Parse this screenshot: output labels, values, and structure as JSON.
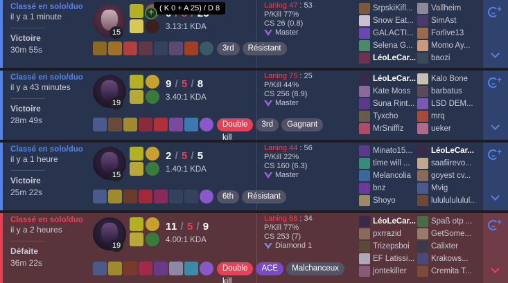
{
  "tooltip": "( K 0 + A 25) / D 8",
  "matches": [
    {
      "result_class": "win",
      "queue": "Classé en solo/duo",
      "ago": "il y a 1 minute",
      "result": "Victoire",
      "duration": "30m 55s",
      "level": "15",
      "kills": "0",
      "deaths": "8",
      "assists": "25",
      "kda_ratio": "3.13:1 KDA",
      "badges": [
        "3rd",
        "Résistant"
      ],
      "laning": "Laning 47",
      "laning_opp": "53",
      "pkill": "P/Kill 77%",
      "cs": "CS 26 (0.8)",
      "rank": "Master",
      "team1": [
        "SrpskiKifl...",
        "Snow Eat...",
        "GALACTI...",
        "Selena G...",
        "LéoLeCar..."
      ],
      "team2": [
        "Vallheim",
        "SimAst",
        "Forlive13",
        "Momo Ay...",
        "baozi"
      ]
    },
    {
      "result_class": "win",
      "queue": "Classé en solo/duo",
      "ago": "il y a 43 minutes",
      "result": "Victoire",
      "duration": "28m 49s",
      "level": "19",
      "kills": "9",
      "deaths": "5",
      "assists": "8",
      "kda_ratio": "3.40:1 KDA",
      "badges": [
        "Double kill",
        "3rd",
        "Gagnant"
      ],
      "laning": "Laning 75",
      "laning_opp": "25",
      "pkill": "P/Kill 44%",
      "cs": "CS 256 (8.9)",
      "rank": "Master",
      "team1": [
        "LéoLeCar...",
        "Kate Moss",
        "Suna Rint...",
        "Tyxcho",
        "MrSnifflz"
      ],
      "team2": [
        "Kalo Bone",
        "barbatus",
        "LSD DEM...",
        "mrq",
        "ueker"
      ]
    },
    {
      "result_class": "win",
      "queue": "Classé en solo/duo",
      "ago": "il y a 1 heure",
      "result": "Victoire",
      "duration": "25m 22s",
      "level": "15",
      "kills": "2",
      "deaths": "5",
      "assists": "5",
      "kda_ratio": "1.40:1 KDA",
      "badges": [
        "6th",
        "Résistant"
      ],
      "laning": "Laning 44",
      "laning_opp": "56",
      "pkill": "P/Kill 22%",
      "cs": "CS 160 (6.3)",
      "rank": "Master",
      "team1": [
        "Minato15...",
        "time will ...",
        "Melancolia",
        "bnz",
        "Shoyo"
      ],
      "team2": [
        "LéoLeCar...",
        "saafiirevo...",
        "goyest cv...",
        "Mvig",
        "lulululululul..."
      ]
    },
    {
      "result_class": "loss",
      "queue": "Classé en solo/duo",
      "ago": "il y a 2 heures",
      "result": "Défaite",
      "duration": "36m 22s",
      "level": "19",
      "kills": "11",
      "deaths": "5",
      "assists": "9",
      "kda_ratio": "4.00:1 KDA",
      "badges": [
        "Double kill",
        "ACE",
        "Malchanceux"
      ],
      "laning": "Laning 66",
      "laning_opp": "34",
      "pkill": "P/Kill 77%",
      "cs": "CS 253 (7)",
      "rank": "Diamond 1",
      "team1": [
        "LéoLeCar...",
        "pxrrazid",
        "Trizepsboi",
        "EF Latissi...",
        "jontekiller"
      ],
      "team2": [
        "Spaß otp ...",
        "GetSome...",
        "Calixter",
        "Krakows...",
        "Cremita T..."
      ]
    }
  ],
  "icons": [
    "share-icon",
    "chevron-down-icon",
    "chevron-up-icon",
    "master-emblem-icon"
  ],
  "colors": {
    "win": "#5383e8",
    "loss": "#e84057",
    "win_bg": "#28344e",
    "loss_bg": "#59343b"
  }
}
